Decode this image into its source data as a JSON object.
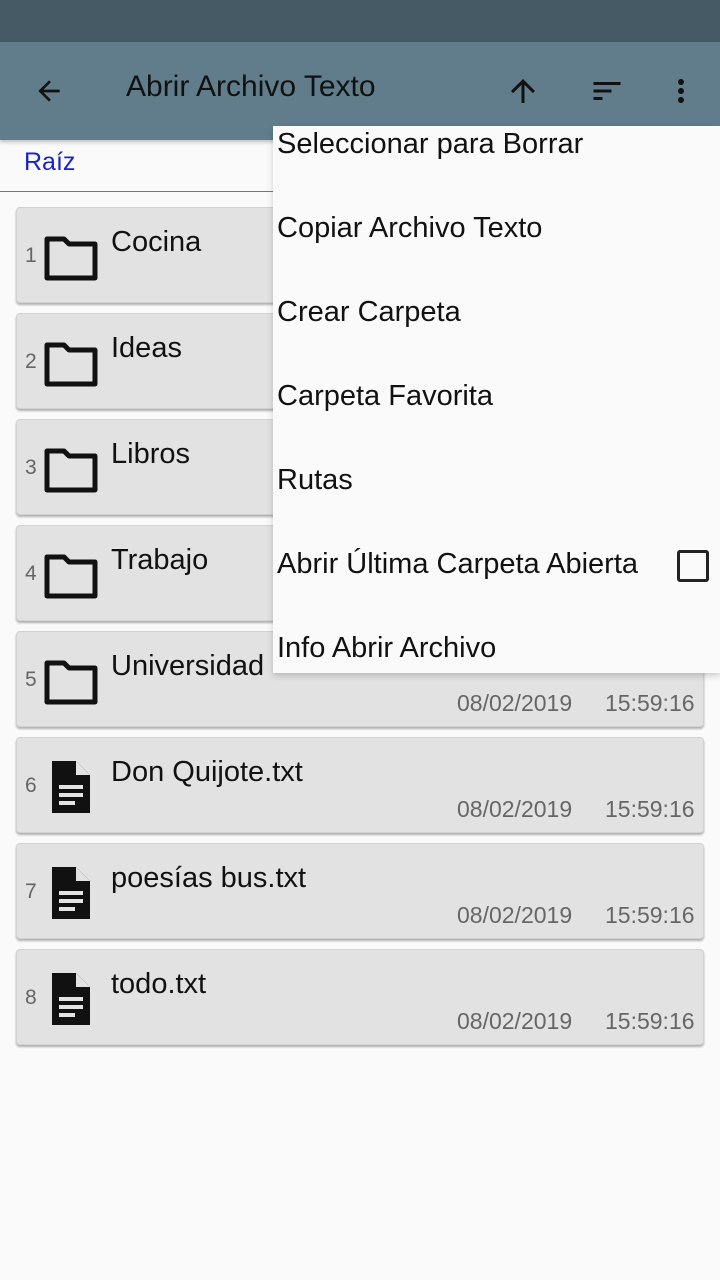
{
  "app_bar": {
    "title": "Abrir Archivo Texto"
  },
  "path": {
    "label": "Raíz"
  },
  "items": [
    {
      "num": "1",
      "name": "Cocina",
      "type": "folder",
      "date": "",
      "time": ""
    },
    {
      "num": "2",
      "name": "Ideas",
      "type": "folder",
      "date": "",
      "time": ""
    },
    {
      "num": "3",
      "name": "Libros",
      "type": "folder",
      "date": "",
      "time": ""
    },
    {
      "num": "4",
      "name": "Trabajo",
      "type": "folder",
      "date": "",
      "time": ""
    },
    {
      "num": "5",
      "name": "Universidad",
      "type": "folder",
      "date": "08/02/2019",
      "time": "15:59:16"
    },
    {
      "num": "6",
      "name": "Don Quijote.txt",
      "type": "file",
      "date": "08/02/2019",
      "time": "15:59:16"
    },
    {
      "num": "7",
      "name": "poesías bus.txt",
      "type": "file",
      "date": "08/02/2019",
      "time": "15:59:16"
    },
    {
      "num": "8",
      "name": "todo.txt",
      "type": "file",
      "date": "08/02/2019",
      "time": "15:59:16"
    }
  ],
  "menu": {
    "items": [
      "Seleccionar para Borrar",
      "Copiar Archivo Texto",
      "Crear Carpeta",
      "Carpeta Favorita",
      "Rutas",
      "Abrir Última Carpeta Abierta",
      "Info Abrir Archivo"
    ],
    "open_last_folder_checked": false
  },
  "icons": {
    "back": "arrow-back-icon",
    "up": "arrow-up-icon",
    "sort": "sort-icon",
    "more": "more-vert-icon",
    "folder": "folder-icon",
    "file": "text-file-icon"
  },
  "colors": {
    "status_bar": "#465a66",
    "app_bar": "#617d8b",
    "path_text": "#1a23c8",
    "row_bg": "#e2e2e2"
  }
}
